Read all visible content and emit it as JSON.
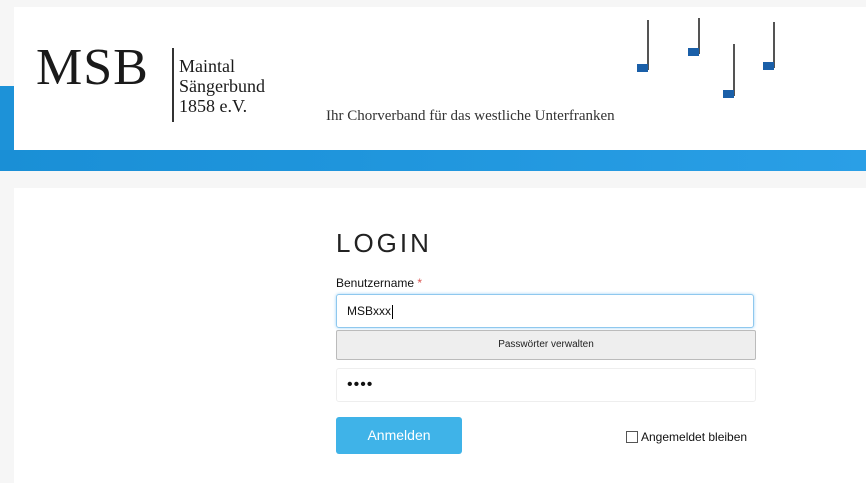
{
  "header": {
    "logo_text": "MSB",
    "logo_lines": [
      "Maintal",
      "Sängerbund",
      "1858 e.V."
    ],
    "tagline": "Ihr Chorverband für das westliche Unterfranken"
  },
  "login": {
    "title": "LOGIN",
    "username_label": "Benutzername",
    "required_mark": "*",
    "username_value": "MSBxxx",
    "password_manager_label": "Passwörter verwalten",
    "password_masked": "••••",
    "submit_label": "Anmelden",
    "remember_label": "Angemeldet bleiben"
  },
  "colors": {
    "brand_blue": "#1d92d8",
    "button_blue": "#3fb3e8",
    "note_blue": "#1a5fa8"
  }
}
